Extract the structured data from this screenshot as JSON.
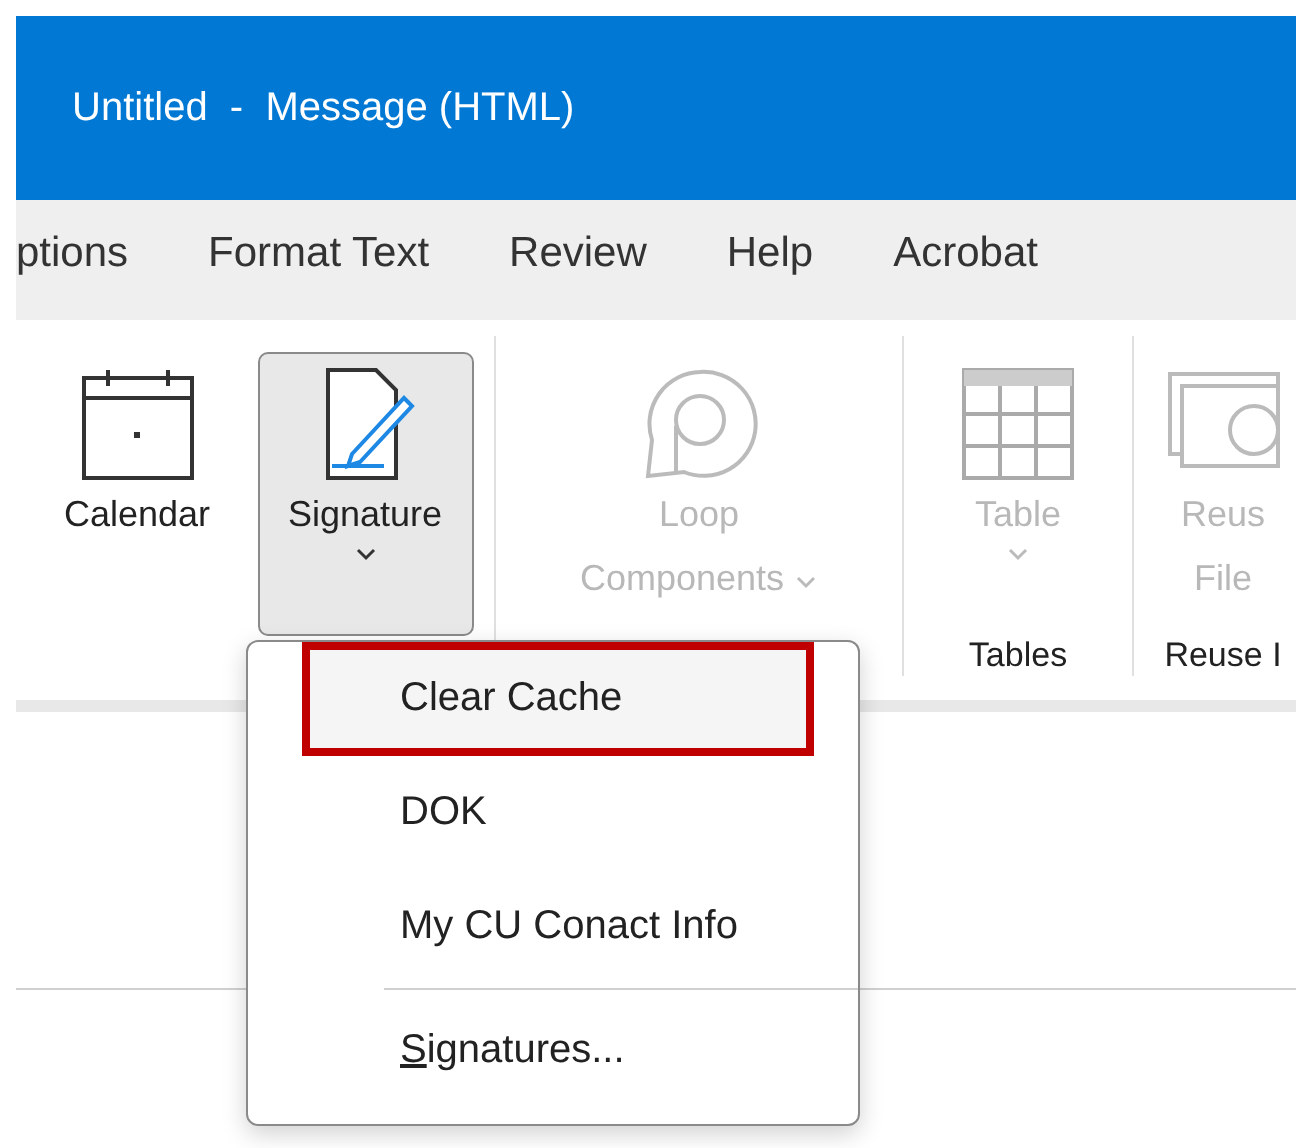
{
  "window": {
    "title": "Untitled  -  Message (HTML)"
  },
  "tabs": [
    {
      "label": "ptions",
      "selected": false
    },
    {
      "label": "Format Text",
      "selected": false
    },
    {
      "label": "Review",
      "selected": false
    },
    {
      "label": "Help",
      "selected": false
    },
    {
      "label": "Acrobat",
      "selected": false
    }
  ],
  "ribbon": {
    "groups": [
      {
        "buttons": [
          {
            "kind": "calendar",
            "lines": [
              "Calendar"
            ],
            "disabled": false,
            "pressed": false,
            "dropdown": false
          },
          {
            "kind": "signature",
            "lines": [
              "Signature"
            ],
            "disabled": false,
            "pressed": true,
            "dropdown": true
          }
        ]
      },
      {
        "buttons": [
          {
            "kind": "loop",
            "lines": [
              "Loop",
              "Components"
            ],
            "disabled": true,
            "pressed": false,
            "dropdown": true
          }
        ]
      },
      {
        "label": "Tables",
        "buttons": [
          {
            "kind": "table",
            "lines": [
              "Table"
            ],
            "disabled": true,
            "pressed": false,
            "dropdown": true
          }
        ]
      },
      {
        "label": "Reuse I",
        "buttons": [
          {
            "kind": "reuse",
            "lines": [
              "Reus",
              "File"
            ],
            "disabled": true,
            "pressed": false,
            "dropdown": false
          }
        ]
      }
    ]
  },
  "signature_menu": {
    "items": [
      {
        "label": "Clear Cache",
        "selected": true,
        "separator_before": false,
        "mnemonic_first": false
      },
      {
        "label": "DOK",
        "selected": false,
        "separator_before": false,
        "mnemonic_first": false
      },
      {
        "label": "My CU Conact Info",
        "selected": false,
        "separator_before": false,
        "mnemonic_first": false
      },
      {
        "label": "Signatures...",
        "selected": false,
        "separator_before": true,
        "mnemonic_first": true
      }
    ]
  }
}
